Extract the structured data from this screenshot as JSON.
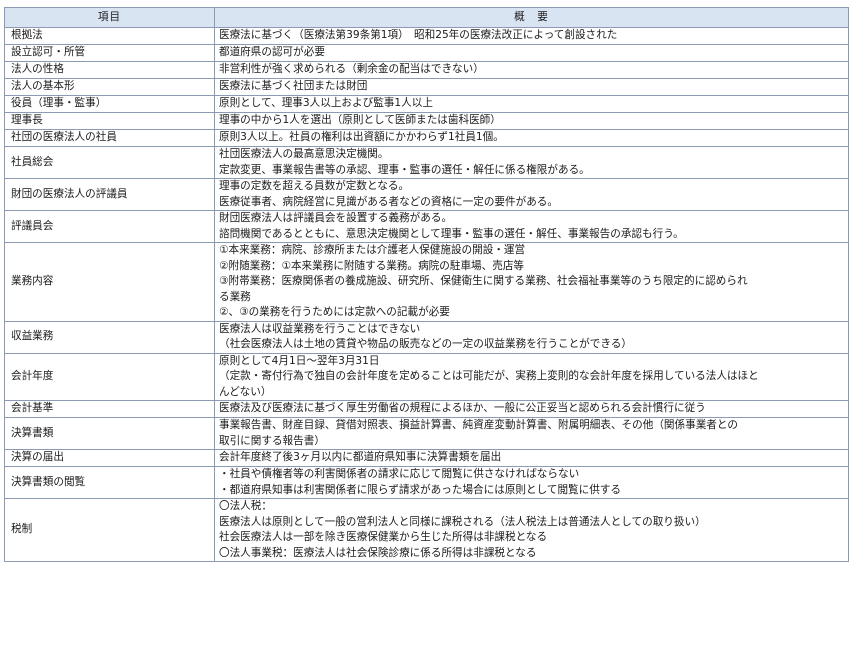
{
  "header": {
    "col1": "項目",
    "col2": "概　要"
  },
  "rows": [
    {
      "item": "根拠法",
      "lines": [
        "医療法に基づく（医療法第39条第1項）　昭和25年の医療法改正によって創設された"
      ]
    },
    {
      "item": "設立認可・所管",
      "lines": [
        "都道府県の認可が必要"
      ]
    },
    {
      "item": "法人の性格",
      "lines": [
        "非営利性が強く求められる（剰余金の配当はできない）"
      ]
    },
    {
      "item": "法人の基本形",
      "lines": [
        "医療法に基づく社団または財団"
      ]
    },
    {
      "item": "役員（理事・監事）",
      "lines": [
        "原則として、理事3人以上および監事1人以上"
      ]
    },
    {
      "item": "理事長",
      "lines": [
        "理事の中から1人を選出（原則として医師または歯科医師）"
      ]
    },
    {
      "item": "社団の医療法人の社員",
      "lines": [
        "原則3人以上。社員の権利は出資額にかかわらず1社員1個。"
      ]
    },
    {
      "item": "社員総会",
      "lines": [
        "社団医療法人の最高意思決定機関。",
        "定款変更、事業報告書等の承認、理事・監事の選任・解任に係る権限がある。"
      ]
    },
    {
      "item": "財団の医療法人の評議員",
      "lines": [
        "理事の定数を超える員数が定数となる。",
        "医療従事者、病院経営に見識がある者などの資格に一定の要件がある。"
      ]
    },
    {
      "item": "評議員会",
      "lines": [
        "財団医療法人は評議員会を設置する義務がある。",
        "諮問機関であるとともに、意思決定機関として理事・監事の選任・解任、事業報告の承認も行う。"
      ]
    },
    {
      "item": "業務内容",
      "lines": [
        "①本来業務：病院、診療所または介護老人保健施設の開設・運営",
        "②附随業務：①本来業務に附随する業務。病院の駐車場、売店等",
        "③附帯業務：医療関係者の養成施設、研究所、保健衛生に関する業務、社会福祉事業等のうち限定的に認められ",
        "る業務",
        "②、③の業務を行うためには定款への記載が必要"
      ]
    },
    {
      "item": "収益業務",
      "lines": [
        "医療法人は収益業務を行うことはできない",
        "（社会医療法人は土地の賃貸や物品の販売などの一定の収益業務を行うことができる）"
      ]
    },
    {
      "item": "会計年度",
      "lines": [
        "原則として4月1日～翌年3月31日",
        "（定款・寄付行為で独自の会計年度を定めることは可能だが、実務上変則的な会計年度を採用している法人はほと",
        "んどない）"
      ]
    },
    {
      "item": "会計基準",
      "lines": [
        "医療法及び医療法に基づく厚生労働省の規程によるほか、一般に公正妥当と認められる会計慣行に従う"
      ]
    },
    {
      "item": "決算書類",
      "lines": [
        "事業報告書、財産目録、貸借対照表、損益計算書、純資産変動計算書、附属明細表、その他（関係事業者との",
        "取引に関する報告書）"
      ]
    },
    {
      "item": "決算の届出",
      "lines": [
        "会計年度終了後3ヶ月以内に都道府県知事に決算書類を届出"
      ]
    },
    {
      "item": "決算書類の閲覧",
      "lines": [
        "・社員や債権者等の利害関係者の請求に応じて閲覧に供さなければならない",
        "・都道府県知事は利害関係者に限らず請求があった場合には原則として閲覧に供する"
      ]
    },
    {
      "item": "税制",
      "lines": [
        "〇法人税：",
        "医療法人は原則として一般の営利法人と同様に課税される（法人税法上は普通法人としての取り扱い）",
        "社会医療法人は一部を除き医療保健業から生じた所得は非課税となる",
        "〇法人事業税：医療法人は社会保険診療に係る所得は非課税となる"
      ]
    }
  ]
}
